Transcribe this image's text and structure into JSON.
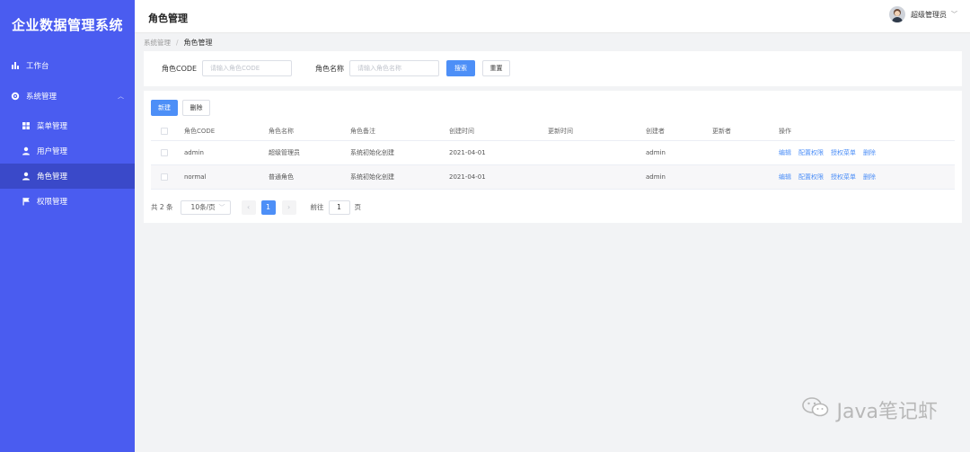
{
  "app": {
    "title": "企业数据管理系统"
  },
  "sidebar": {
    "items": [
      {
        "label": "工作台",
        "icon": "bar-chart-icon"
      },
      {
        "label": "系统管理",
        "icon": "gear-icon"
      },
      {
        "label": "菜单管理",
        "icon": "grid-icon"
      },
      {
        "label": "用户管理",
        "icon": "user-icon"
      },
      {
        "label": "角色管理",
        "icon": "user-icon",
        "active": true
      },
      {
        "label": "权限管理",
        "icon": "flag-icon"
      }
    ]
  },
  "header": {
    "title": "角色管理",
    "user": "超级管理员"
  },
  "breadcrumb": {
    "parent": "系统管理",
    "separator": "/",
    "current": "角色管理"
  },
  "search": {
    "code_label": "角色CODE",
    "code_placeholder": "请输入角色CODE",
    "name_label": "角色名称",
    "name_placeholder": "请输入角色名称",
    "search_btn": "搜索",
    "reset_btn": "重置"
  },
  "toolbar": {
    "add": "新建",
    "delete": "删除"
  },
  "table": {
    "columns": [
      "角色CODE",
      "角色名称",
      "角色备注",
      "创建时间",
      "更新时间",
      "创建者",
      "更新者",
      "操作"
    ],
    "rows": [
      {
        "code": "admin",
        "name": "超级管理员",
        "remark": "系统初始化创建",
        "created": "2021-04-01",
        "updated": "",
        "creator": "admin",
        "updater": ""
      },
      {
        "code": "normal",
        "name": "普通角色",
        "remark": "系统初始化创建",
        "created": "2021-04-01",
        "updated": "",
        "creator": "admin",
        "updater": ""
      }
    ],
    "actions": [
      "编辑",
      "配置权限",
      "授权菜单",
      "删除"
    ]
  },
  "pagination": {
    "total": "共 2 条",
    "page_size": "10条/页",
    "prev": "‹",
    "current_page": "1",
    "next": "›",
    "goto_label": "前往",
    "goto_value": "1",
    "page_suffix": "页"
  },
  "watermark": {
    "text": "Java笔记虾"
  },
  "colors": {
    "sidebar": "#4a5cf0",
    "sidebar_active": "#3a49c9",
    "primary": "#4d8ff7"
  }
}
